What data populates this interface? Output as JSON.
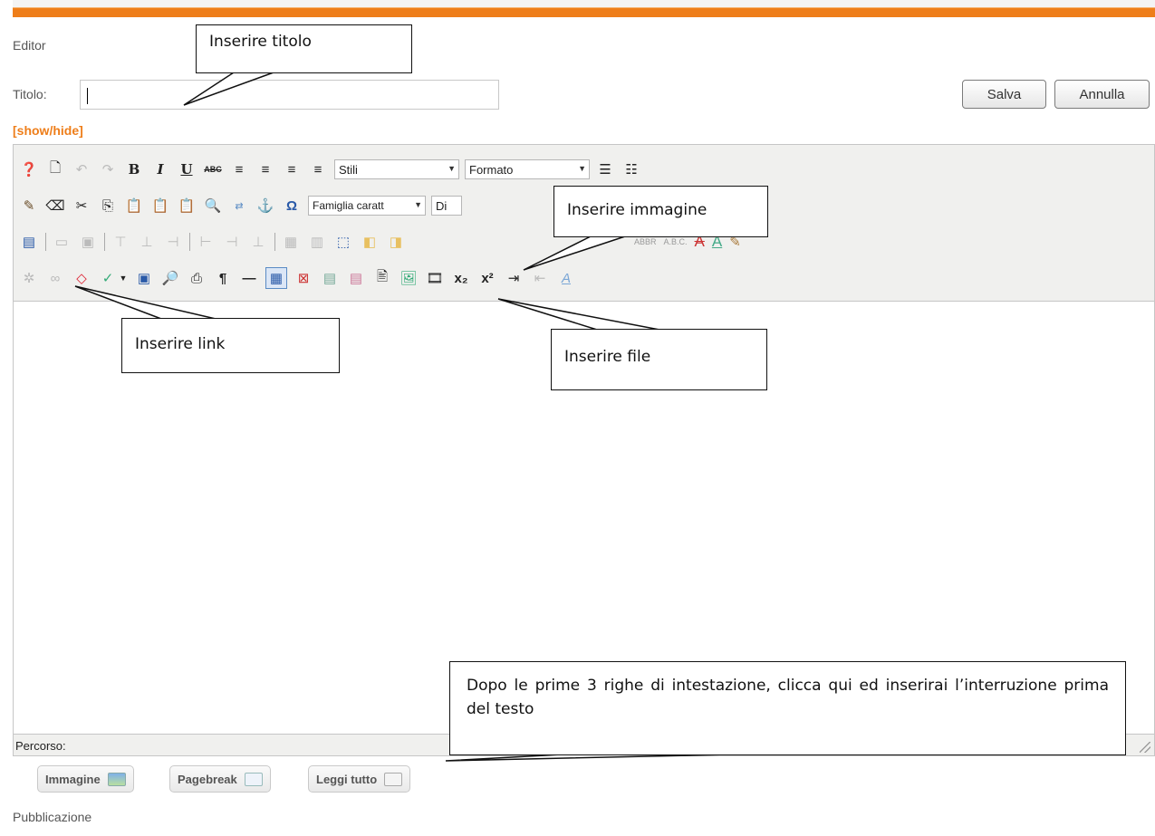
{
  "header": {
    "section_label": "Editor",
    "title_label": "Titolo:",
    "title_value": ""
  },
  "actions": {
    "save_label": "Salva",
    "cancel_label": "Annulla"
  },
  "toggle": {
    "label": "[show/hide]"
  },
  "toolbar": {
    "styles_select": "Stili",
    "format_select": "Formato",
    "font_family_select": "Famiglia caratt",
    "font_size_select": "Di"
  },
  "statusbar": {
    "path_label": "Percorso:"
  },
  "editor_buttons": [
    {
      "label": "Immagine",
      "icon": "image-icon"
    },
    {
      "label": "Pagebreak",
      "icon": "pagebreak-icon"
    },
    {
      "label": "Leggi tutto",
      "icon": "readmore-icon"
    }
  ],
  "footer": {
    "section_label": "Pubblicazione"
  },
  "callouts": {
    "title": "Inserire titolo",
    "image": "Inserire immagine",
    "link": "Inserire link",
    "file": "Inserire file",
    "readmore": "Dopo le prime 3 righe di intestazione, clicca qui ed inserirai l’interruzione prima del testo"
  },
  "colors": {
    "accent": "#ee7e1a",
    "toolbar_bg": "#f0f0ee"
  }
}
